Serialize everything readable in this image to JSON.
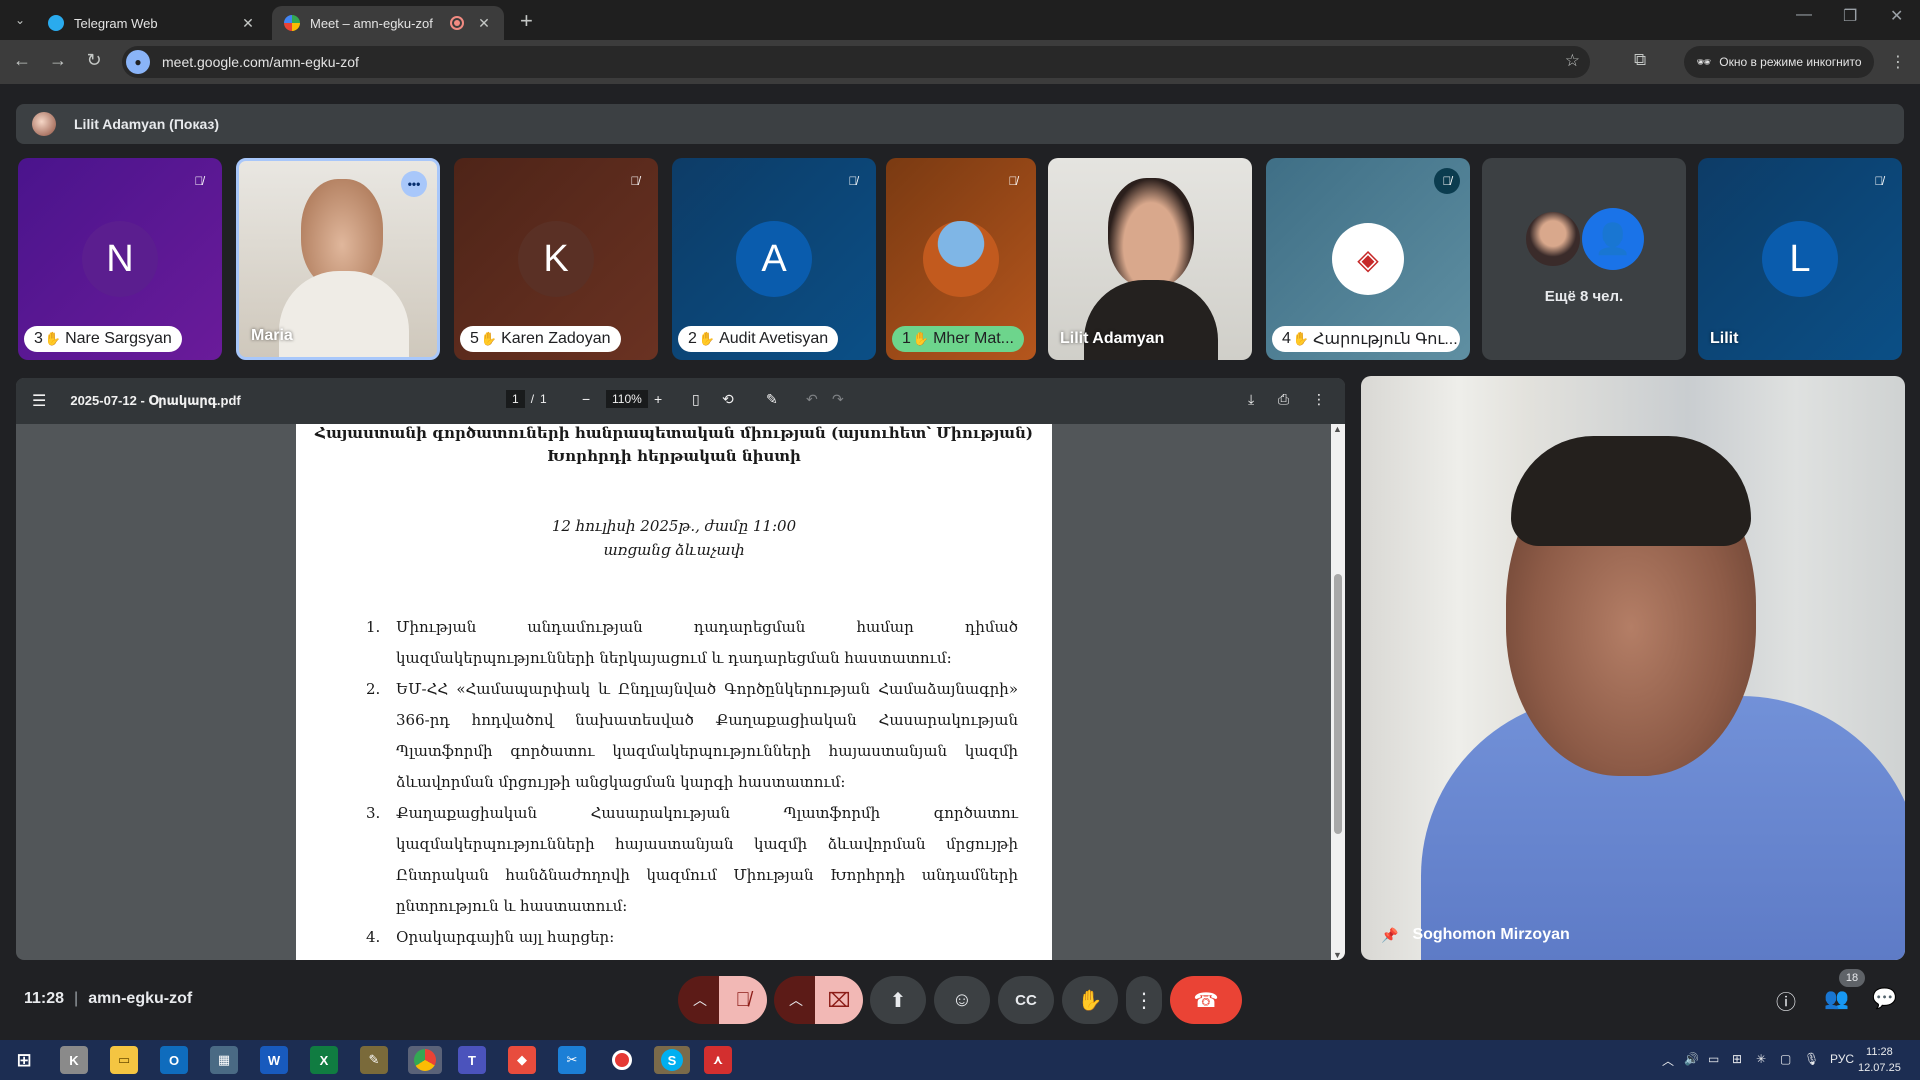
{
  "browser": {
    "tabs": [
      {
        "title": "Telegram Web",
        "icon": "telegram-icon"
      },
      {
        "title": "Meet – amn-egku-zof",
        "icon": "google-meet-icon"
      }
    ],
    "url": "meet.google.com/amn-egku-zof",
    "incognito_label": "Окно в режиме инкогнито"
  },
  "meet": {
    "presenting_banner": "Lilit Adamyan (Показ)",
    "participants": [
      {
        "hand": "3",
        "name": "Nare Sargsyan",
        "letter": "N",
        "muted": true
      },
      {
        "hand": "",
        "name": "Maria",
        "letter": "",
        "muted": false
      },
      {
        "hand": "5",
        "name": "Karen Zadoyan",
        "letter": "K",
        "muted": true
      },
      {
        "hand": "2",
        "name": "Audit Avetisyan",
        "letter": "A",
        "muted": true
      },
      {
        "hand": "1",
        "name": "Mher Mat...",
        "letter": "",
        "muted": true
      },
      {
        "hand": "",
        "name": "Lilit Adamyan",
        "letter": "",
        "muted": false
      },
      {
        "hand": "4",
        "name": "Հարություն Գու...",
        "letter": "",
        "muted": true
      },
      {
        "hand": "",
        "name": "Ещё 8 чел.",
        "letter": "",
        "muted": false
      },
      {
        "hand": "",
        "name": "Lilit",
        "letter": "L",
        "muted": true
      }
    ],
    "speaker_name": "Soghomon Mirzoyan",
    "time": "11:28",
    "meeting_code": "amn-egku-zof",
    "people_count": "18"
  },
  "pdf": {
    "filename": "2025-07-12 - Օրակարգ.pdf",
    "page_current": "1",
    "page_sep": "/",
    "page_total": "1",
    "zoom": "110%",
    "heading_line1": "Հայաստանի գործատուների հանրապետական միության (այսուհետ՝ Միության)",
    "heading_line2": "Խորհրդի հերթական նիստի",
    "date_line": "12 հուլիսի 2025թ., ժամը 11:00",
    "mode_line": "առցանց ձևաչափ",
    "items": [
      {
        "num": "1.",
        "text": "Միության անդամության դադարեցման համար դիմած կազմակերպությունների ներկայացում և դադարեցման հաստատում:"
      },
      {
        "num": "2.",
        "text": "ԵՄ-ՀՀ «Համապարփակ և Ընդլայնված Գործընկերության Համաձայնագրի» 366-րդ հոդվածով նախատեսված Քաղաքացիական Հասարակության Պլատֆորմի գործատու կազմակերպությունների հայաստանյան կազմի ձևավորման մրցույթի անցկացման կարգի հաստատում:"
      },
      {
        "num": "3.",
        "text": "Քաղաքացիական Հասարակության Պլատֆորմի գործատու կազմակերպությունների հայաստանյան կազմի ձևավորման մրցույթի Ընտրական հանձնաժողովի կազմում Միության Խորհրդի անդամների ընտրություն և հաստատում:"
      },
      {
        "num": "4.",
        "text": "Օրակարգային այլ հարցեր:"
      }
    ]
  },
  "taskbar": {
    "tray_lang": "РУС",
    "clock_time": "11:28",
    "clock_date": "12.07.25"
  },
  "colors": {
    "meet_bg": "#202124",
    "hangup_red": "#ea4335",
    "taskbar": "#1c2d52"
  }
}
